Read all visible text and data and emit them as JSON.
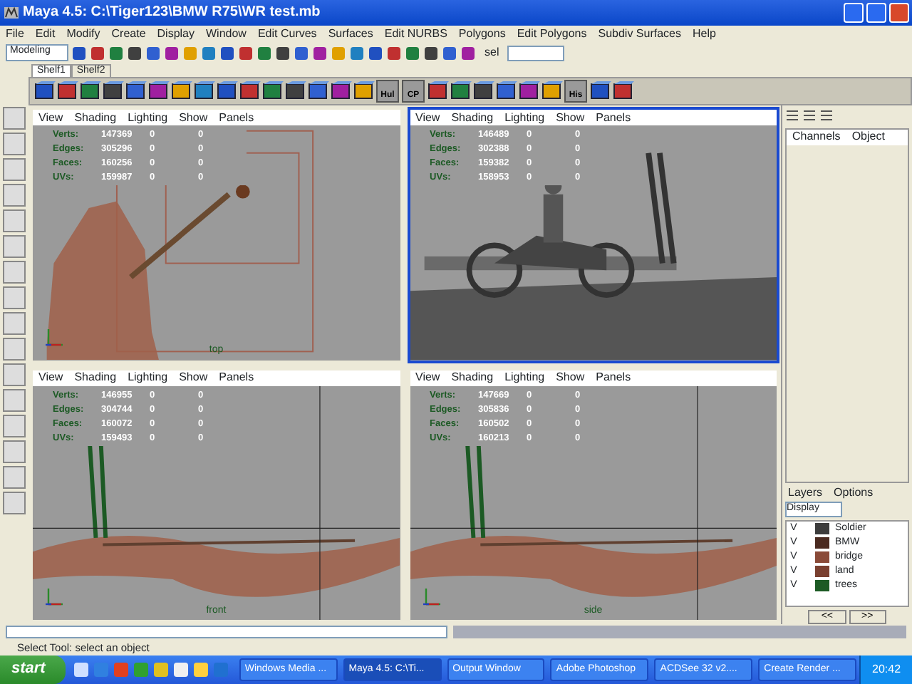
{
  "window": {
    "title": "Maya 4.5: C:\\Tiger123\\BMW R75\\WR test.mb"
  },
  "menu": [
    "File",
    "Edit",
    "Modify",
    "Create",
    "Display",
    "Window",
    "Edit Curves",
    "Surfaces",
    "Edit NURBS",
    "Polygons",
    "Edit Polygons",
    "Subdiv Surfaces",
    "Help"
  ],
  "mode_menu": {
    "value": "Modeling"
  },
  "selection_field": {
    "label": "sel"
  },
  "shelf_tabs": [
    {
      "label": "Shelf1",
      "selected": true
    },
    {
      "label": "Shelf2",
      "selected": false
    }
  ],
  "shelf": [
    {
      "kind": "tool"
    },
    {
      "kind": "tool"
    },
    {
      "kind": "tool"
    },
    {
      "kind": "tool"
    },
    {
      "kind": "tool"
    },
    {
      "kind": "tool"
    },
    {
      "kind": "tool"
    },
    {
      "kind": "tool"
    },
    {
      "kind": "tool"
    },
    {
      "kind": "tool"
    },
    {
      "kind": "tool"
    },
    {
      "kind": "tool"
    },
    {
      "kind": "tool"
    },
    {
      "kind": "tool"
    },
    {
      "kind": "tool"
    },
    {
      "kind": "captioned",
      "caption": "Hul"
    },
    {
      "kind": "captioned",
      "caption": "CP"
    },
    {
      "kind": "tool"
    },
    {
      "kind": "tool"
    },
    {
      "kind": "tool"
    },
    {
      "kind": "tool"
    },
    {
      "kind": "tool"
    },
    {
      "kind": "tool"
    },
    {
      "kind": "captioned",
      "caption": "His"
    },
    {
      "kind": "tool"
    },
    {
      "kind": "tool"
    }
  ],
  "viewports": [
    {
      "menu": [
        "View",
        "Shading",
        "Lighting",
        "Show",
        "Panels"
      ],
      "selected": false,
      "kind": "ortho_top",
      "camera_label": "top",
      "stats": [
        {
          "label": "Verts:",
          "value": "147369",
          "col_3": "0",
          "col_4": "0"
        },
        {
          "label": "Edges:",
          "value": "305296",
          "col_3": "0",
          "col_4": "0"
        },
        {
          "label": "Faces:",
          "value": "160256",
          "col_3": "0",
          "col_4": "0"
        },
        {
          "label": "UVs:",
          "value": "159987",
          "col_3": "0",
          "col_4": "0"
        }
      ]
    },
    {
      "menu": [
        "View",
        "Shading",
        "Lighting",
        "Show",
        "Panels"
      ],
      "selected": true,
      "kind": "persp",
      "stats": [
        {
          "label": "Verts:",
          "value": "146489",
          "col_3": "0",
          "col_4": "0"
        },
        {
          "label": "Edges:",
          "value": "302388",
          "col_3": "0",
          "col_4": "0"
        },
        {
          "label": "Faces:",
          "value": "159382",
          "col_3": "0",
          "col_4": "0"
        },
        {
          "label": "UVs:",
          "value": "158953",
          "col_3": "0",
          "col_4": "0"
        }
      ]
    },
    {
      "menu": [
        "View",
        "Shading",
        "Lighting",
        "Show",
        "Panels"
      ],
      "selected": false,
      "kind": "ortho_side",
      "camera_label": "front",
      "stats": [
        {
          "label": "Verts:",
          "value": "146955",
          "col_3": "0",
          "col_4": "0"
        },
        {
          "label": "Edges:",
          "value": "304744",
          "col_3": "0",
          "col_4": "0"
        },
        {
          "label": "Faces:",
          "value": "160072",
          "col_3": "0",
          "col_4": "0"
        },
        {
          "label": "UVs:",
          "value": "159493",
          "col_3": "0",
          "col_4": "0"
        }
      ]
    },
    {
      "menu": [
        "View",
        "Shading",
        "Lighting",
        "Show",
        "Panels"
      ],
      "selected": false,
      "kind": "ortho_side",
      "camera_label": "side",
      "stats": [
        {
          "label": "Verts:",
          "value": "147669",
          "col_3": "0",
          "col_4": "0"
        },
        {
          "label": "Edges:",
          "value": "305836",
          "col_3": "0",
          "col_4": "0"
        },
        {
          "label": "Faces:",
          "value": "160502",
          "col_3": "0",
          "col_4": "0"
        },
        {
          "label": "UVs:",
          "value": "160213",
          "col_3": "0",
          "col_4": "0"
        }
      ]
    }
  ],
  "channel_box": {
    "menu": [
      "Channels",
      "Object"
    ]
  },
  "layers": {
    "menu": [
      "Layers",
      "Options"
    ],
    "display_menu": "Display",
    "items": [
      {
        "visible": "V",
        "name": "Soldier",
        "color": "#3c3c3c"
      },
      {
        "visible": "V",
        "name": "BMW",
        "color": "#4a2a20"
      },
      {
        "visible": "V",
        "name": "bridge",
        "color": "#8a4a38"
      },
      {
        "visible": "V",
        "name": "land",
        "color": "#7a4030"
      },
      {
        "visible": "V",
        "name": "trees",
        "color": "#1c5a24"
      }
    ],
    "scroll_buttons": [
      "<<",
      ">>"
    ]
  },
  "help_line": "Select Tool: select an object",
  "taskbar": {
    "start": "start",
    "items": [
      {
        "label": "Windows Media ...",
        "selected": false
      },
      {
        "label": "Maya 4.5: C:\\Ti...",
        "selected": true
      },
      {
        "label": "Output Window",
        "selected": false
      },
      {
        "label": "Adobe Photoshop",
        "selected": false
      },
      {
        "label": "ACDSee 32 v2....",
        "selected": false
      },
      {
        "label": "Create Render ...",
        "selected": false
      }
    ],
    "clock": "20:42"
  }
}
